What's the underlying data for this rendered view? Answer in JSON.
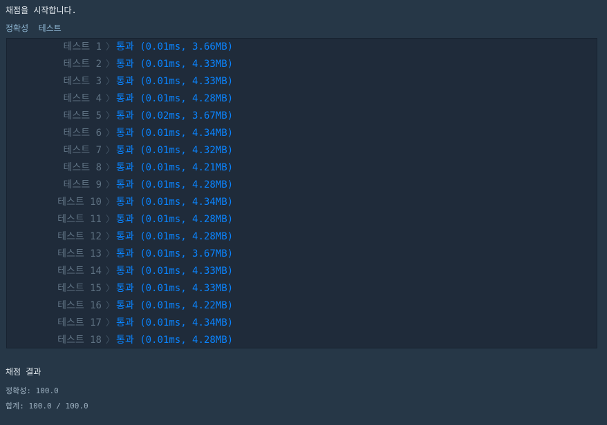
{
  "header": {
    "start_message": "채점을 시작합니다.",
    "section_title": "정확성  테스트"
  },
  "results": [
    {
      "name": "테스트 1",
      "result": "통과 (0.01ms, 3.66MB)"
    },
    {
      "name": "테스트 2",
      "result": "통과 (0.01ms, 4.33MB)"
    },
    {
      "name": "테스트 3",
      "result": "통과 (0.01ms, 4.33MB)"
    },
    {
      "name": "테스트 4",
      "result": "통과 (0.01ms, 4.28MB)"
    },
    {
      "name": "테스트 5",
      "result": "통과 (0.02ms, 3.67MB)"
    },
    {
      "name": "테스트 6",
      "result": "통과 (0.01ms, 4.34MB)"
    },
    {
      "name": "테스트 7",
      "result": "통과 (0.01ms, 4.32MB)"
    },
    {
      "name": "테스트 8",
      "result": "통과 (0.01ms, 4.21MB)"
    },
    {
      "name": "테스트 9",
      "result": "통과 (0.01ms, 4.28MB)"
    },
    {
      "name": "테스트 10",
      "result": "통과 (0.01ms, 4.34MB)"
    },
    {
      "name": "테스트 11",
      "result": "통과 (0.01ms, 4.28MB)"
    },
    {
      "name": "테스트 12",
      "result": "통과 (0.01ms, 4.28MB)"
    },
    {
      "name": "테스트 13",
      "result": "통과 (0.01ms, 3.67MB)"
    },
    {
      "name": "테스트 14",
      "result": "통과 (0.01ms, 4.33MB)"
    },
    {
      "name": "테스트 15",
      "result": "통과 (0.01ms, 4.33MB)"
    },
    {
      "name": "테스트 16",
      "result": "통과 (0.01ms, 4.22MB)"
    },
    {
      "name": "테스트 17",
      "result": "통과 (0.01ms, 4.34MB)"
    },
    {
      "name": "테스트 18",
      "result": "통과 (0.01ms, 4.28MB)"
    }
  ],
  "summary": {
    "title": "채점 결과",
    "accuracy": "정확성: 100.0",
    "total": "합계: 100.0 / 100.0"
  },
  "icons": {
    "row_chevron": "chevron-right-icon"
  },
  "colors": {
    "background": "#263747",
    "panel": "#1f2b3a",
    "pass": "#0a84ff",
    "test_label": "#5f7283"
  }
}
